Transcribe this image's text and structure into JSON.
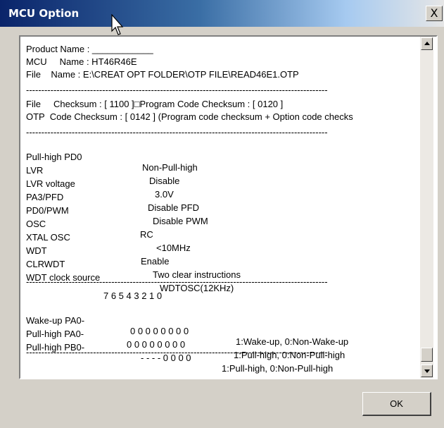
{
  "window": {
    "title": "MCU Option",
    "close_label": "X"
  },
  "header": {
    "product": "Product Name : ____________",
    "mcu": "MCU     Name : HT46R46E",
    "file": "File    Name : E:\\CREAT OPT FOLDER\\OTP FILE\\READ46E1.OTP"
  },
  "separator": "---------------------------------------------------------------------------------------------------",
  "checksum": {
    "file": "File     Checksum : [ 1100 ]□Program Code Checksum : [ 0120 ]",
    "otp": "OTP  Code Checksum : [ 0142 ] (Program code checksum + Option code checks"
  },
  "options": [
    {
      "name": "Pull-high PD0",
      "value": "Non-Pull-high"
    },
    {
      "name": "LVR",
      "value": "Disable"
    },
    {
      "name": "LVR voltage",
      "value": "3.0V"
    },
    {
      "name": "PA3/PFD",
      "value": "Disable PFD"
    },
    {
      "name": "PD0/PWM",
      "value": "Disable PWM"
    },
    {
      "name": "OSC",
      "value": "RC"
    },
    {
      "name": "XTAL OSC",
      "value": "<10MHz"
    },
    {
      "name": "WDT",
      "value": "Enable"
    },
    {
      "name": "CLRWDT",
      "value": "Two clear instructions"
    },
    {
      "name": "WDT clock source",
      "value": "WDTOSC(12KHz)"
    }
  ],
  "bits": {
    "header": "7 6 5 4 3 2 1 0",
    "rows": [
      {
        "name": "Wake-up PA0-",
        "bits": "0 0 0 0 0 0 0 0",
        "desc": "1:Wake-up, 0:Non-Wake-up"
      },
      {
        "name": "Pull-high PA0-",
        "bits": "0 0 0 0 0 0 0 0",
        "desc": "1:Pull-high, 0:Non-Pull-high"
      },
      {
        "name": "Pull-high PB0-",
        "bits": "- - - - 0 0 0 0",
        "desc": "1:Pull-high, 0:Non-Pull-high"
      }
    ]
  },
  "buttons": {
    "ok": "OK"
  }
}
